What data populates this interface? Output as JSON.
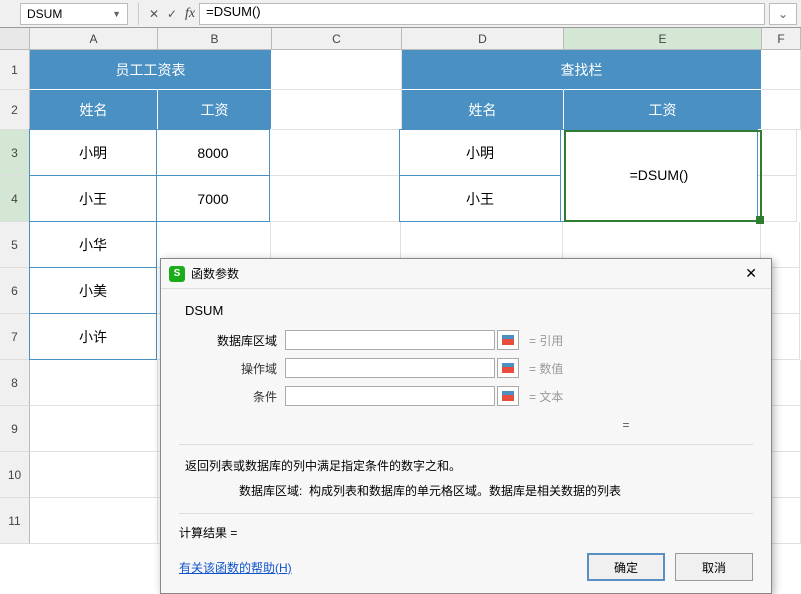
{
  "formula_bar": {
    "name_box": "DSUM",
    "formula": "=DSUM()",
    "cancel": "✕",
    "confirm": "✓"
  },
  "columns": [
    "A",
    "B",
    "C",
    "D",
    "E",
    "F"
  ],
  "rows": [
    "1",
    "2",
    "3",
    "4",
    "5",
    "6",
    "7",
    "8",
    "9",
    "10",
    "11"
  ],
  "table1": {
    "title": "员工工资表",
    "h1": "姓名",
    "h2": "工资",
    "r": [
      {
        "name": "小明",
        "val": "8000"
      },
      {
        "name": "小王",
        "val": "7000"
      },
      {
        "name": "小华",
        "val": ""
      },
      {
        "name": "小美",
        "val": ""
      },
      {
        "name": "小许",
        "val": ""
      }
    ]
  },
  "table2": {
    "title": "查找栏",
    "h1": "姓名",
    "h2": "工资",
    "r": [
      {
        "name": "小明",
        "val": ""
      },
      {
        "name": "小王",
        "val": ""
      }
    ],
    "merged_val": "=DSUM()"
  },
  "dialog": {
    "title": "函数参数",
    "func": "DSUM",
    "params": [
      {
        "label": "数据库区域",
        "hint": "= 引用"
      },
      {
        "label": "操作域",
        "hint": "= 数值"
      },
      {
        "label": "条件",
        "hint": "= 文本"
      }
    ],
    "equals": "=",
    "desc": "返回列表或数据库的列中满足指定条件的数字之和。",
    "param_desc_label": "数据库区域:",
    "param_desc": "构成列表和数据库的单元格区域。数据库是相关数据的列表",
    "result_label": "计算结果 =",
    "help": "有关该函数的帮助(H)",
    "ok": "确定",
    "cancel": "取消"
  }
}
